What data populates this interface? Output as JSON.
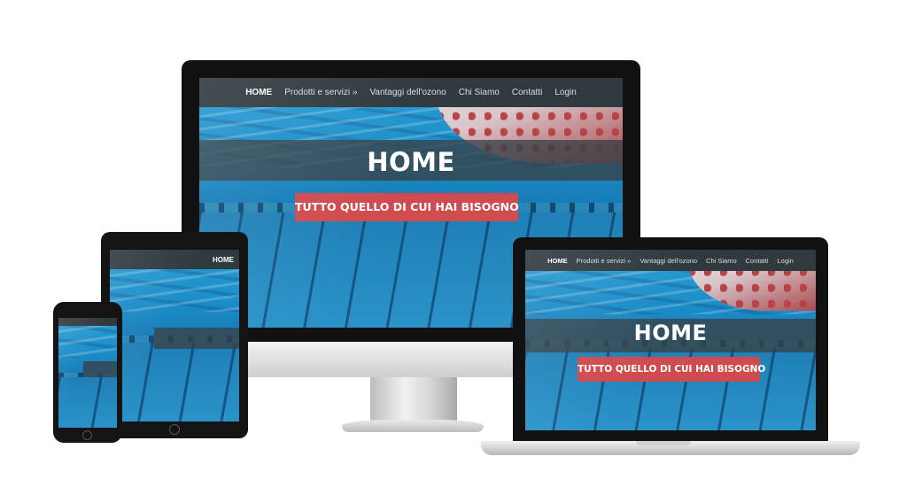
{
  "site": {
    "nav": {
      "home": "HOME",
      "products": "Prodotti e servizi »",
      "advantages": "Vantaggi dell'ozono",
      "about": "Chi Siamo",
      "contacts": "Contatti",
      "login": "Login"
    },
    "hero": {
      "title": "HOME",
      "cta": "TUTTO QUELLO DI CUI HAI BISOGNO"
    }
  },
  "colors": {
    "nav_bg": "#2f3a3f",
    "cta_bg": "#cf4b4f",
    "pool_water": "#1b8cc8"
  },
  "devices": [
    "desktop-monitor",
    "tablet",
    "smartphone",
    "laptop"
  ]
}
